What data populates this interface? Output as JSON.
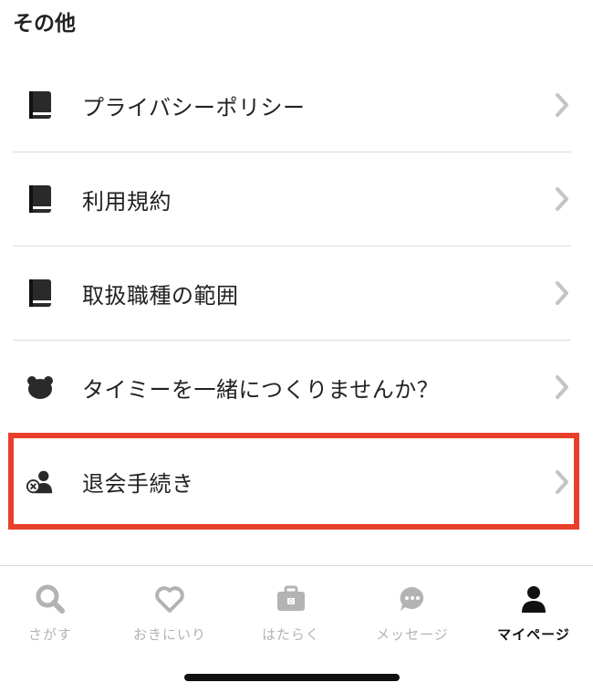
{
  "section": {
    "title": "その他"
  },
  "menu": [
    {
      "label": "プライバシーポリシー",
      "icon": "book-icon"
    },
    {
      "label": "利用規約",
      "icon": "book-icon"
    },
    {
      "label": "取扱職種の範囲",
      "icon": "book-icon"
    },
    {
      "label": "タイミーを一緒につくりませんか？",
      "icon": "bear-icon"
    },
    {
      "label": "退会手続き",
      "icon": "user-remove-icon",
      "highlighted": true
    }
  ],
  "tabs": [
    {
      "label": "さがす",
      "icon": "search-icon"
    },
    {
      "label": "おきにいり",
      "icon": "heart-icon"
    },
    {
      "label": "はたらく",
      "icon": "briefcase-icon",
      "badge": "0"
    },
    {
      "label": "メッセージ",
      "icon": "chat-bubble-icon"
    },
    {
      "label": "マイページ",
      "icon": "person-icon",
      "active": true
    }
  ],
  "colors": {
    "highlight": "#e8402a",
    "tab_inactive": "#b3b3b3",
    "tab_active": "#111111"
  }
}
